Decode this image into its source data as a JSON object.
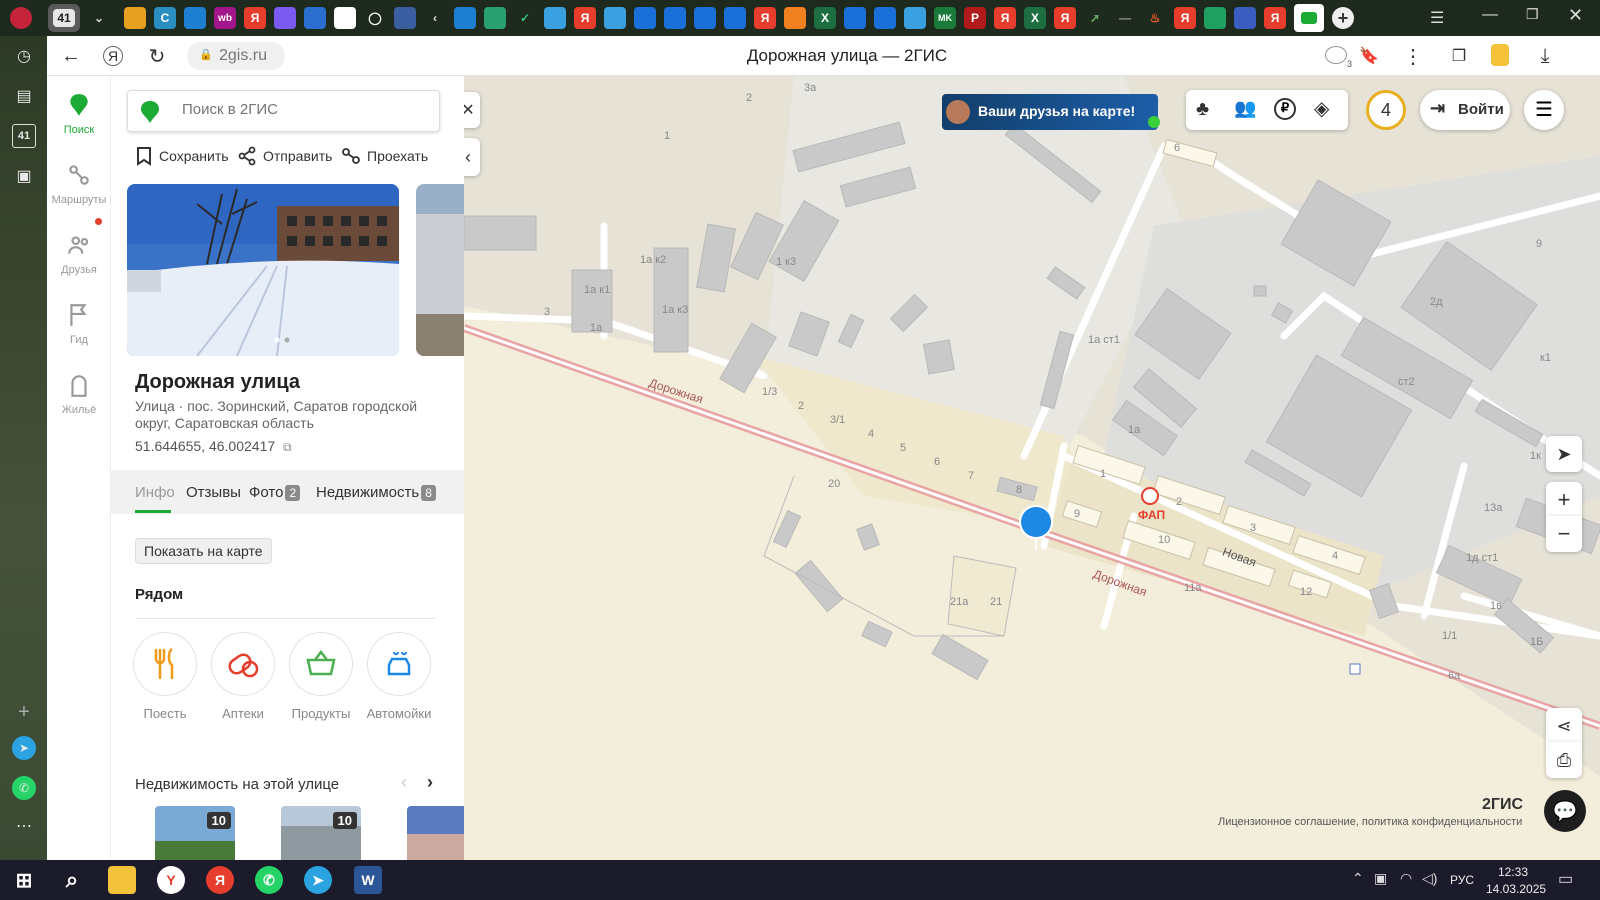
{
  "browser": {
    "tab_badge": "41",
    "url": "2gis.ru",
    "page_title": "Дорожная улица — 2ГИС",
    "notifications_count": "3"
  },
  "browser_sidebar": {
    "badge": "41"
  },
  "nav": {
    "items": [
      {
        "label": "Поиск",
        "icon": "search-icon"
      },
      {
        "label": "Маршруты",
        "icon": "route-icon"
      },
      {
        "label": "Друзья",
        "icon": "friends-icon"
      },
      {
        "label": "Гид",
        "icon": "flag-icon"
      },
      {
        "label": "Жильё",
        "icon": "house-icon"
      }
    ]
  },
  "card": {
    "search_placeholder": "Поиск в 2ГИС",
    "actions": {
      "save": "Сохранить",
      "share": "Отправить",
      "route": "Проехать"
    },
    "title": "Дорожная улица",
    "subtitle": "Улица · пос. Зоринский, Саратов городской округ, Саратовская область",
    "coords": "51.644655, 46.002417",
    "tabs": [
      {
        "label": "Инфо",
        "count": ""
      },
      {
        "label": "Отзывы",
        "count": ""
      },
      {
        "label": "Фото",
        "count": "2"
      },
      {
        "label": "Недвижимость",
        "count": "8"
      }
    ],
    "show_on_map": "Показать на карте",
    "nearby_title": "Рядом",
    "nearby": [
      {
        "label": "Поесть",
        "icon": "fork-knife-icon"
      },
      {
        "label": "Аптеки",
        "icon": "pill-icon"
      },
      {
        "label": "Продукты",
        "icon": "basket-icon"
      },
      {
        "label": "Автомойки",
        "icon": "car-wash-icon"
      }
    ],
    "realty_title": "Недвижимость на этой улице",
    "realty_badges": [
      "10",
      "10"
    ]
  },
  "map": {
    "friends_banner": "Ваши друзья на карте!",
    "points_count": "4",
    "login": "Войти",
    "street_label_1": "Дорожная",
    "street_label_2": "Дорожная",
    "street_label_3": "Новая",
    "poi_fap": "ФАП",
    "brand": "2ГИС",
    "license": "Лицензионное соглашение, политика конфиденциальности",
    "numbers": [
      "2",
      "3а",
      "1",
      "3",
      "1а к2",
      "1 к3",
      "1а к1",
      "1а к3",
      "1а",
      "3",
      "1/3",
      "2",
      "3/1",
      "4",
      "5",
      "6",
      "7",
      "8",
      "9",
      "1",
      "2",
      "3",
      "4",
      "10",
      "11а",
      "12",
      "20",
      "21а",
      "21",
      "1а ст1",
      "1а",
      "2д",
      "ст2",
      "1к",
      "13а",
      "1д ст1",
      "1в",
      "1Б",
      "1/1",
      "6а",
      "6",
      "5",
      "9",
      "8",
      "к1"
    ]
  },
  "taskbar": {
    "lang": "РУС",
    "time": "12:33",
    "date": "14.03.2025"
  },
  "colors": {
    "accent_green": "#1BAA33",
    "map_bg": "#f3eedb",
    "road_red": "#e8a4a4",
    "pin_blue": "#1e88e5"
  }
}
